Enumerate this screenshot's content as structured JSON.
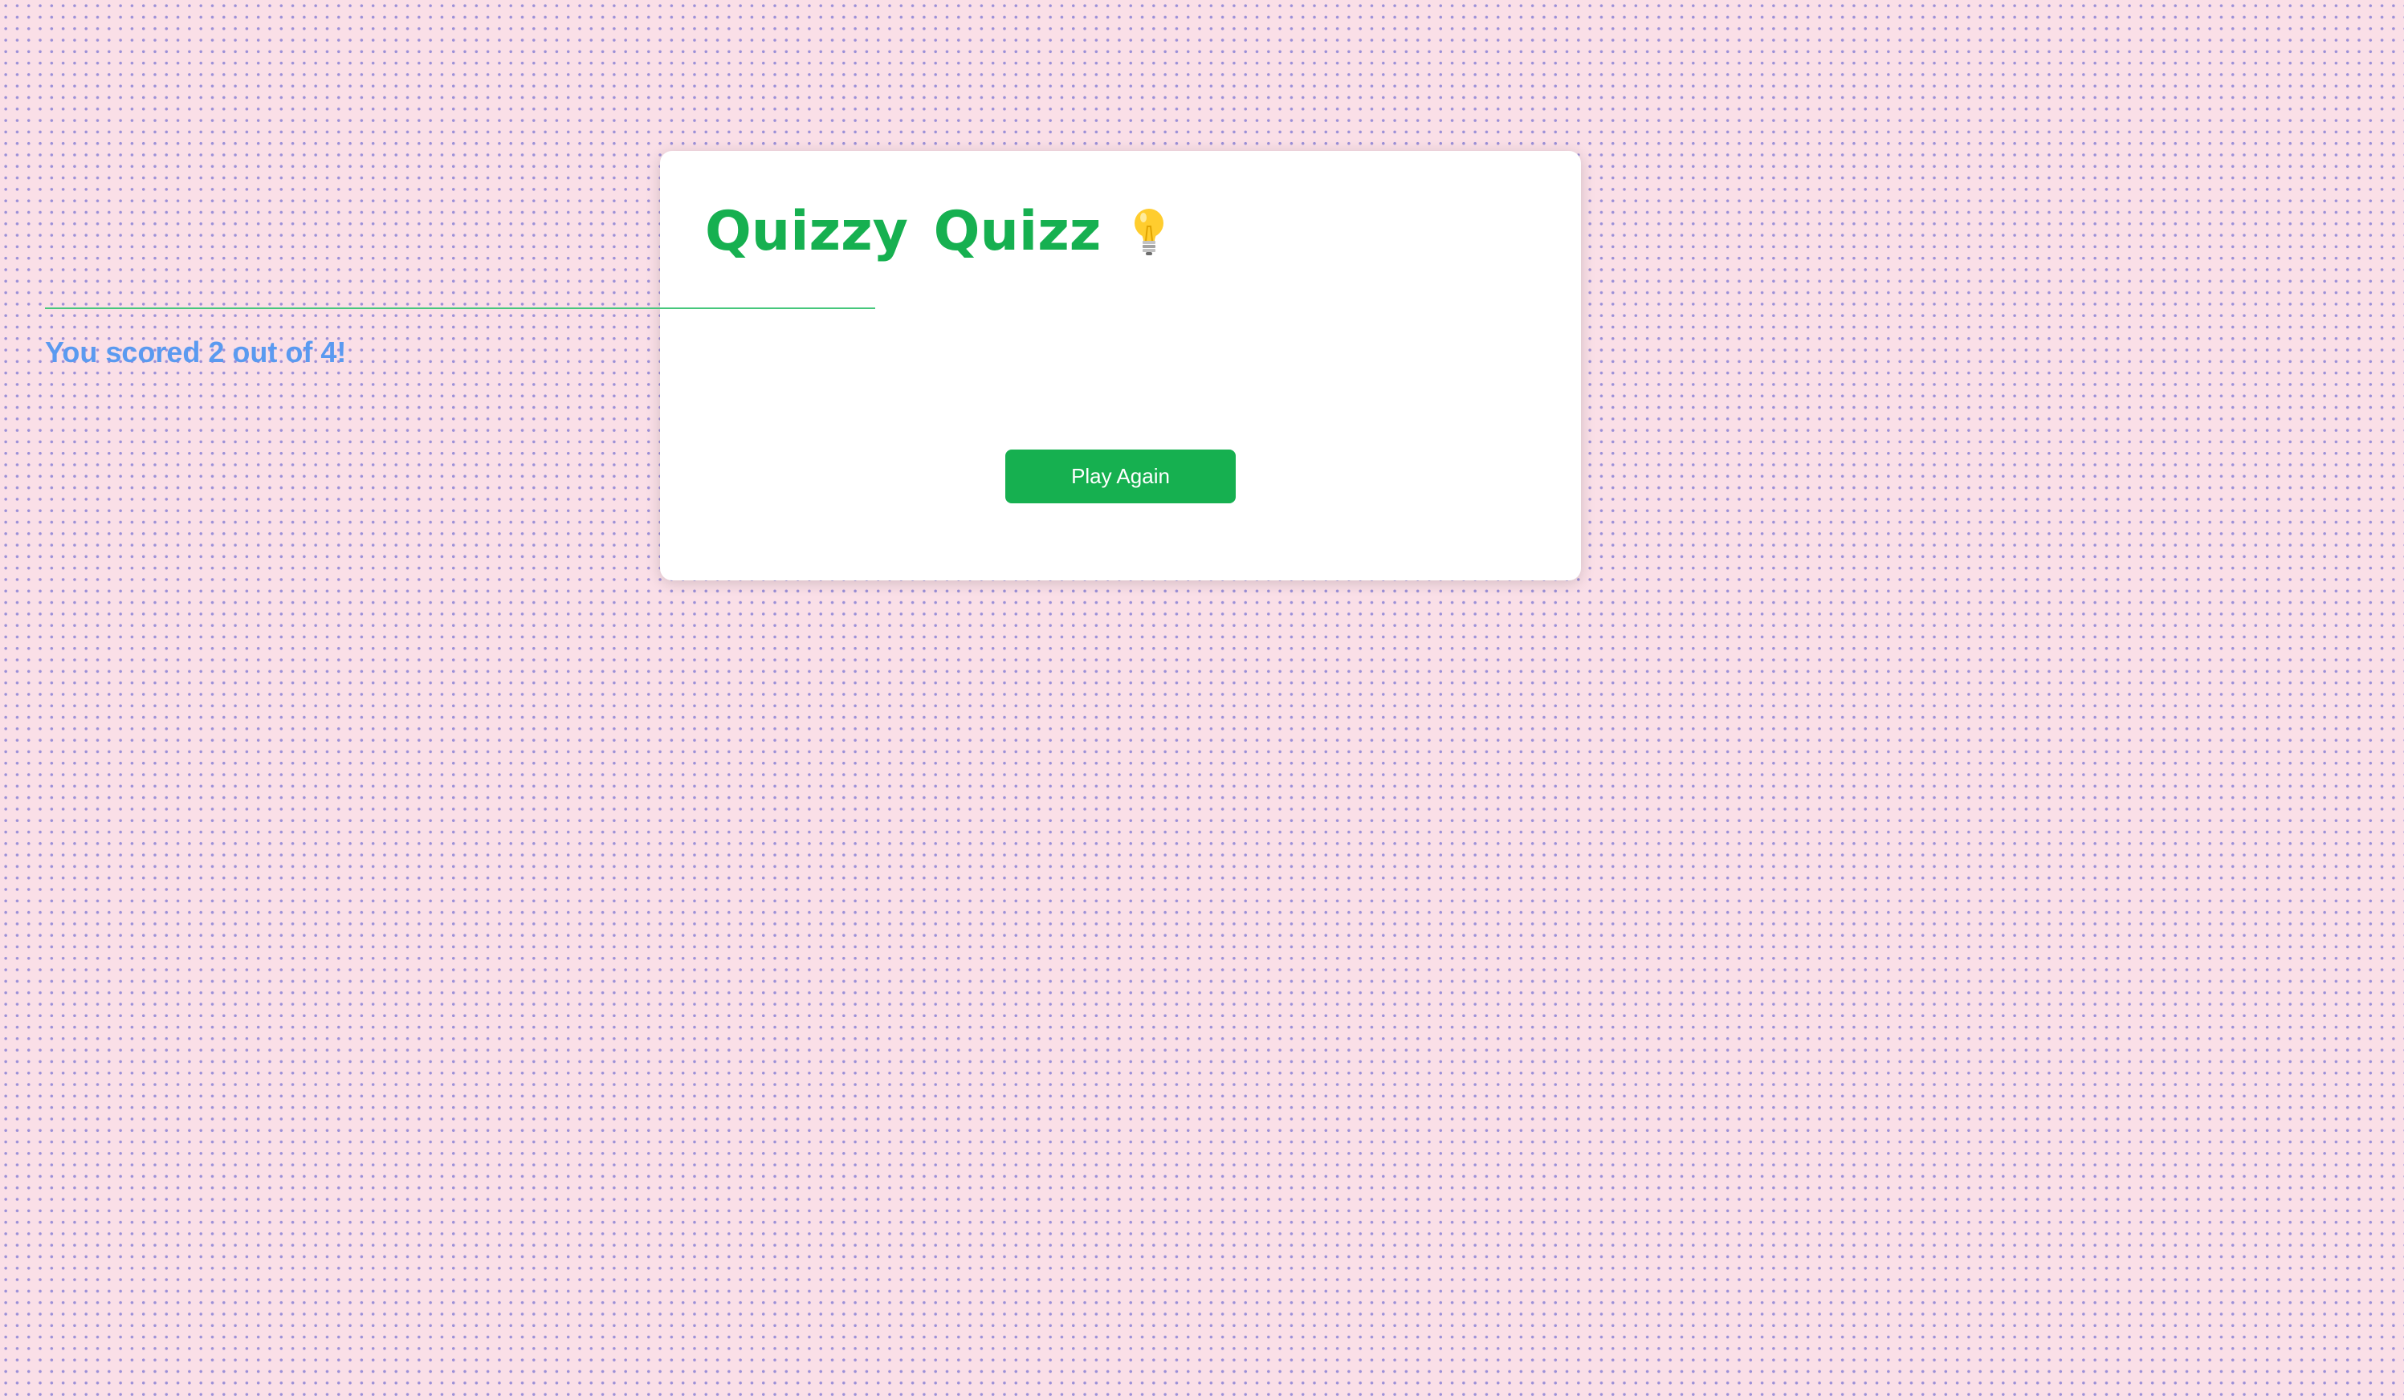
{
  "quiz": {
    "title": "Quizzy Quizz",
    "title_icon": "lightbulb-icon",
    "score_text": "You scored 2 out of 4!",
    "play_again_label": "Play Again"
  },
  "colors": {
    "accent": "#16b050",
    "score_text": "#5a9af0",
    "background": "#fadfe7",
    "card": "#ffffff"
  }
}
